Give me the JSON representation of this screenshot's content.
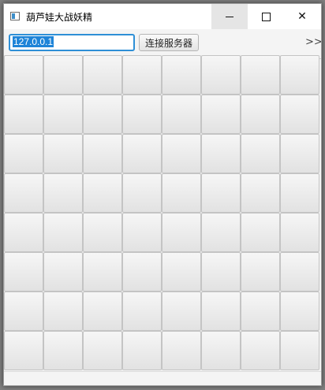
{
  "window": {
    "title": "葫芦娃大战妖精",
    "minimize_glyph": "",
    "maximize_glyph": "",
    "close_glyph": "✕"
  },
  "toolbar": {
    "ip_value": "127.0.0.1",
    "connect_label": "连接服务器",
    "overflow_label": ">>"
  },
  "board": {
    "rows": 8,
    "cols": 8
  }
}
